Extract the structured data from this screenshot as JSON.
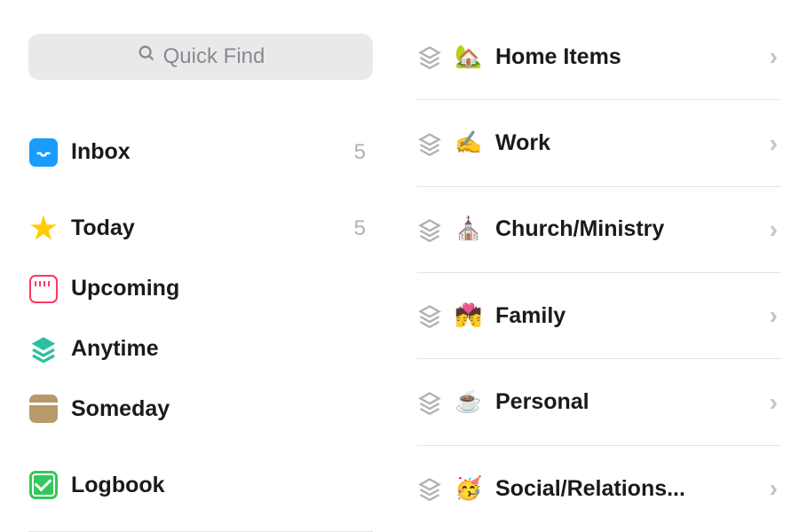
{
  "search": {
    "placeholder": "Quick Find"
  },
  "nav": {
    "inbox": {
      "label": "Inbox",
      "count": "5"
    },
    "today": {
      "label": "Today",
      "count": "5"
    },
    "upcoming": {
      "label": "Upcoming"
    },
    "anytime": {
      "label": "Anytime"
    },
    "someday": {
      "label": "Someday"
    },
    "logbook": {
      "label": "Logbook"
    }
  },
  "areas": [
    {
      "emoji": "🏡",
      "label": "Home Items"
    },
    {
      "emoji": "✍️",
      "label": "Work"
    },
    {
      "emoji": "⛪",
      "label": "Church/Ministry"
    },
    {
      "emoji": "💏",
      "label": "Family"
    },
    {
      "emoji": "☕",
      "label": "Personal"
    },
    {
      "emoji": "🥳",
      "label": "Social/Relations..."
    }
  ]
}
